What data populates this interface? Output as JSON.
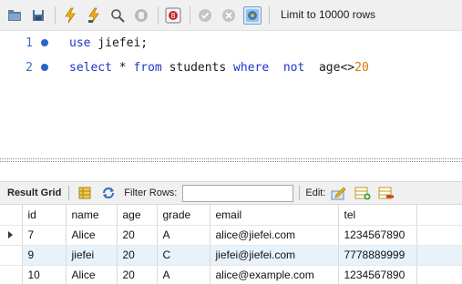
{
  "toolbar": {
    "buttons": [
      {
        "name": "open-file-icon"
      },
      {
        "name": "save-icon"
      },
      {
        "name": "execute-icon"
      },
      {
        "name": "execute-current-icon"
      },
      {
        "name": "explain-icon"
      },
      {
        "name": "stop-icon"
      },
      {
        "name": "toggle-continue-on-error-icon"
      },
      {
        "name": "commit-icon"
      },
      {
        "name": "rollback-icon"
      },
      {
        "name": "autocommit-icon"
      }
    ],
    "limit_label": "Limit to 10000 rows"
  },
  "editor": {
    "lines": [
      {
        "number": "1",
        "text_parts": [
          {
            "t": "use",
            "c": "kw"
          },
          {
            "t": " jiefei;",
            "c": "plain"
          }
        ]
      },
      {
        "number": "2",
        "text_parts": [
          {
            "t": "select",
            "c": "kw"
          },
          {
            "t": " * ",
            "c": "plain"
          },
          {
            "t": "from",
            "c": "kw"
          },
          {
            "t": " students ",
            "c": "plain"
          },
          {
            "t": "where",
            "c": "kw"
          },
          {
            "t": "  ",
            "c": "plain"
          },
          {
            "t": "not",
            "c": "kw"
          },
          {
            "t": "  age<>",
            "c": "plain"
          },
          {
            "t": "20",
            "c": "num"
          }
        ]
      }
    ]
  },
  "result_toolbar": {
    "result_grid_label": "Result Grid",
    "filter_label": "Filter Rows:",
    "filter_value": "",
    "edit_label": "Edit:"
  },
  "grid": {
    "columns": [
      "id",
      "name",
      "age",
      "grade",
      "email",
      "tel"
    ],
    "rows": [
      [
        "7",
        "Alice",
        "20",
        "A",
        "alice@jiefei.com",
        "1234567890"
      ],
      [
        "9",
        "jiefei",
        "20",
        "C",
        "jiefei@jiefei.com",
        "7778889999"
      ],
      [
        "10",
        "Alice",
        "20",
        "A",
        "alice@example.com",
        "1234567890"
      ]
    ],
    "current_row": 0
  },
  "colors": {
    "keyword": "#1f33c8",
    "number": "#d27a00",
    "alt_row": "#e8f2fb"
  }
}
